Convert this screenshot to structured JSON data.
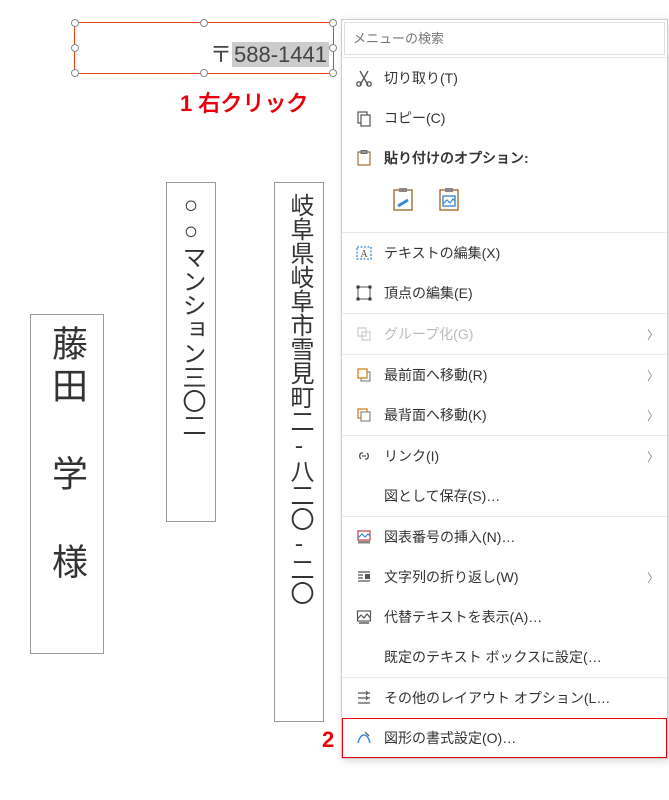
{
  "textbox": {
    "postal_mark": "〒",
    "postal_number": "588-1441"
  },
  "annotations": {
    "step1": "1 右クリック",
    "step2": "2"
  },
  "envelope": {
    "address": "岐阜県岐阜市雪見町二‐八二〇‐二〇",
    "building": "○○マンション三〇二",
    "name": "藤田 学 様"
  },
  "context_menu": {
    "search_placeholder": "メニューの検索",
    "cut": "切り取り(T)",
    "copy": "コピー(C)",
    "paste_options_label": "貼り付けのオプション:",
    "edit_text": "テキストの編集(X)",
    "edit_vertices": "頂点の編集(E)",
    "group": "グループ化(G)",
    "bring_front": "最前面へ移動(R)",
    "send_back": "最背面へ移動(K)",
    "link": "リンク(I)",
    "save_as_picture": "図として保存(S)…",
    "insert_caption": "図表番号の挿入(N)…",
    "text_wrapping": "文字列の折り返し(W)",
    "alt_text": "代替テキストを表示(A)…",
    "set_default_textbox": "既定のテキスト ボックスに設定(…",
    "more_layout": "その他のレイアウト オプション(L…",
    "format_shape": "図形の書式設定(O)…"
  }
}
